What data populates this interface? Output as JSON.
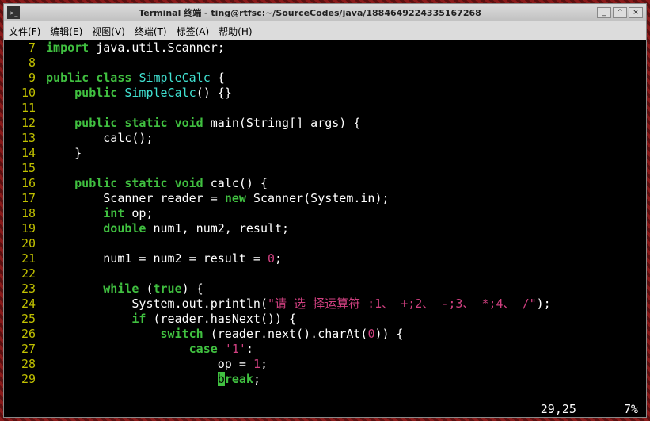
{
  "titlebar": {
    "title": "Terminal 终端 - ting@rtfsc:~/SourceCodes/java/1884649224335167268"
  },
  "window_controls": {
    "min": "_",
    "max": "^",
    "close": "×"
  },
  "menubar": [
    {
      "label": "文件",
      "key": "F"
    },
    {
      "label": "编辑",
      "key": "E"
    },
    {
      "label": "视图",
      "key": "V"
    },
    {
      "label": "终端",
      "key": "T"
    },
    {
      "label": "标签",
      "key": "A"
    },
    {
      "label": "帮助",
      "key": "H"
    }
  ],
  "code": {
    "lines": [
      {
        "n": 7,
        "tokens": [
          {
            "t": " ",
            "c": ""
          },
          {
            "t": "import",
            "c": "kw"
          },
          {
            "t": " java.util.Scanner;",
            "c": ""
          }
        ]
      },
      {
        "n": 8,
        "tokens": [
          {
            "t": "",
            "c": ""
          }
        ]
      },
      {
        "n": 9,
        "tokens": [
          {
            "t": " ",
            "c": ""
          },
          {
            "t": "public",
            "c": "kw"
          },
          {
            "t": " ",
            "c": ""
          },
          {
            "t": "class",
            "c": "kw"
          },
          {
            "t": " ",
            "c": ""
          },
          {
            "t": "SimpleCalc",
            "c": "id"
          },
          {
            "t": " {",
            "c": ""
          }
        ]
      },
      {
        "n": 10,
        "tokens": [
          {
            "t": "     ",
            "c": ""
          },
          {
            "t": "public",
            "c": "kw"
          },
          {
            "t": " ",
            "c": ""
          },
          {
            "t": "SimpleCalc",
            "c": "id"
          },
          {
            "t": "() {}",
            "c": ""
          }
        ]
      },
      {
        "n": 11,
        "tokens": [
          {
            "t": "",
            "c": ""
          }
        ]
      },
      {
        "n": 12,
        "tokens": [
          {
            "t": "     ",
            "c": ""
          },
          {
            "t": "public",
            "c": "kw"
          },
          {
            "t": " ",
            "c": ""
          },
          {
            "t": "static",
            "c": "kw"
          },
          {
            "t": " ",
            "c": ""
          },
          {
            "t": "void",
            "c": "type"
          },
          {
            "t": " main(String[] args) {",
            "c": ""
          }
        ]
      },
      {
        "n": 13,
        "tokens": [
          {
            "t": "         calc();",
            "c": ""
          }
        ]
      },
      {
        "n": 14,
        "tokens": [
          {
            "t": "     }",
            "c": ""
          }
        ]
      },
      {
        "n": 15,
        "tokens": [
          {
            "t": "",
            "c": ""
          }
        ]
      },
      {
        "n": 16,
        "tokens": [
          {
            "t": "     ",
            "c": ""
          },
          {
            "t": "public",
            "c": "kw"
          },
          {
            "t": " ",
            "c": ""
          },
          {
            "t": "static",
            "c": "kw"
          },
          {
            "t": " ",
            "c": ""
          },
          {
            "t": "void",
            "c": "type"
          },
          {
            "t": " calc() {",
            "c": ""
          }
        ]
      },
      {
        "n": 17,
        "tokens": [
          {
            "t": "         Scanner reader = ",
            "c": ""
          },
          {
            "t": "new",
            "c": "kw"
          },
          {
            "t": " Scanner(System.in);",
            "c": ""
          }
        ]
      },
      {
        "n": 18,
        "tokens": [
          {
            "t": "         ",
            "c": ""
          },
          {
            "t": "int",
            "c": "type"
          },
          {
            "t": " op;",
            "c": ""
          }
        ]
      },
      {
        "n": 19,
        "tokens": [
          {
            "t": "         ",
            "c": ""
          },
          {
            "t": "double",
            "c": "type"
          },
          {
            "t": " num1, num2, result;",
            "c": ""
          }
        ]
      },
      {
        "n": 20,
        "tokens": [
          {
            "t": "",
            "c": ""
          }
        ]
      },
      {
        "n": 21,
        "tokens": [
          {
            "t": "         num1 = num2 = result = ",
            "c": ""
          },
          {
            "t": "0",
            "c": "num"
          },
          {
            "t": ";",
            "c": ""
          }
        ]
      },
      {
        "n": 22,
        "tokens": [
          {
            "t": "",
            "c": ""
          }
        ]
      },
      {
        "n": 23,
        "tokens": [
          {
            "t": "         ",
            "c": ""
          },
          {
            "t": "while",
            "c": "kw"
          },
          {
            "t": " (",
            "c": ""
          },
          {
            "t": "true",
            "c": "kw"
          },
          {
            "t": ") {",
            "c": ""
          }
        ]
      },
      {
        "n": 24,
        "tokens": [
          {
            "t": "             System.out.println(",
            "c": ""
          },
          {
            "t": "\"请 选 择运算符 :1、 +;2、 -;3、 *;4、 /\"",
            "c": "str"
          },
          {
            "t": ");",
            "c": ""
          }
        ]
      },
      {
        "n": 25,
        "tokens": [
          {
            "t": "             ",
            "c": ""
          },
          {
            "t": "if",
            "c": "kw"
          },
          {
            "t": " (reader.hasNext()) {",
            "c": ""
          }
        ]
      },
      {
        "n": 26,
        "tokens": [
          {
            "t": "                 ",
            "c": ""
          },
          {
            "t": "switch",
            "c": "kw"
          },
          {
            "t": " (reader.next().charAt(",
            "c": ""
          },
          {
            "t": "0",
            "c": "num"
          },
          {
            "t": ")) {",
            "c": ""
          }
        ]
      },
      {
        "n": 27,
        "tokens": [
          {
            "t": "                     ",
            "c": ""
          },
          {
            "t": "case",
            "c": "kw"
          },
          {
            "t": " ",
            "c": ""
          },
          {
            "t": "'1'",
            "c": "char"
          },
          {
            "t": ":",
            "c": ""
          }
        ]
      },
      {
        "n": 28,
        "tokens": [
          {
            "t": "                         op = ",
            "c": ""
          },
          {
            "t": "1",
            "c": "num"
          },
          {
            "t": ";",
            "c": ""
          }
        ]
      },
      {
        "n": 29,
        "tokens": [
          {
            "t": "                         ",
            "c": ""
          },
          {
            "t": "b",
            "c": "cursor"
          },
          {
            "t": "reak",
            "c": "kw"
          },
          {
            "t": ";",
            "c": ""
          }
        ]
      }
    ]
  },
  "status": {
    "pos": "29,25",
    "pct": "7%"
  }
}
